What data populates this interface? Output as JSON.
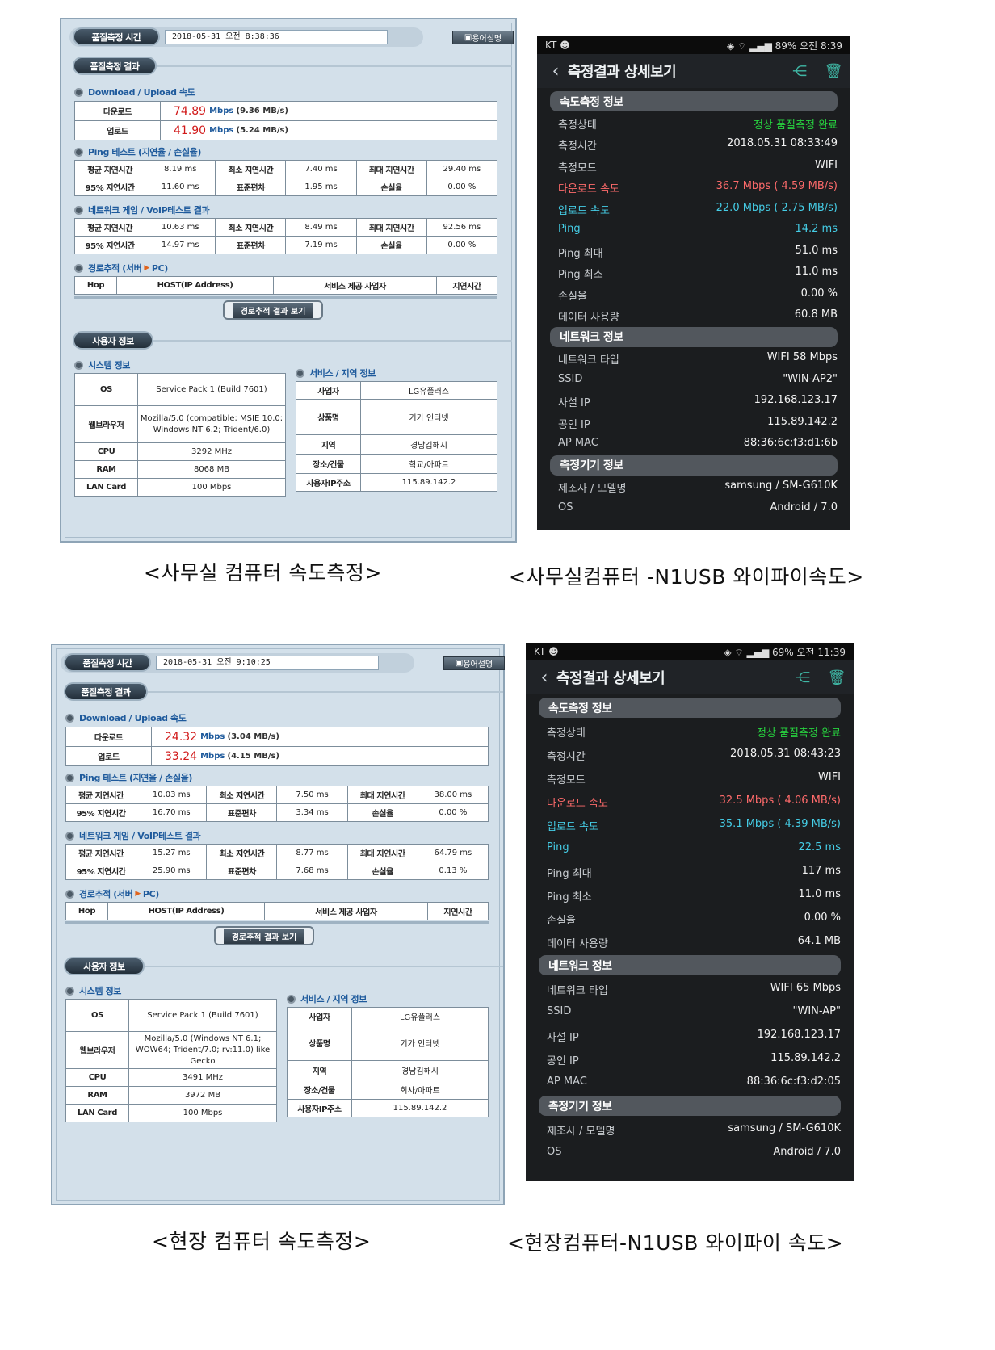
{
  "labels": {
    "time_title": "품질측정 시간",
    "help_button": "용어설명",
    "result_title": "품질측정 결과",
    "dl_ul_title": "Download / Upload 속도",
    "download": "다운로드",
    "upload": "업로드",
    "ping_title": "Ping 테스트 (지연율 / 손실율)",
    "voip_title": "네트워크 게임 / VoIP테스트 결과",
    "avg_delay": "평균 지연시간",
    "min_delay": "최소 지연시간",
    "max_delay": "최대 지연시간",
    "p95_delay": "95% 지연시간",
    "stddev": "표준편차",
    "loss": "손실율",
    "route_title_a": "경로추적 (서버",
    "route_title_b": "PC)",
    "hop": "Hop",
    "host": "HOST(IP Address)",
    "isp_col": "서비스 제공 사업자",
    "delay_col": "지연시간",
    "route_button": "경로추적 결과 보기",
    "user_title": "사용자 정보",
    "system_title": "시스템 정보",
    "service_title": "서비스 / 지역 정보",
    "os": "OS",
    "browser": "웹브라우저",
    "cpu": "CPU",
    "ram": "RAM",
    "lan": "LAN Card",
    "provider": "사업자",
    "product": "상품명",
    "region": "지역",
    "place": "장소/건물",
    "user_ip": "사용자IP주소",
    "mbps": "Mbps"
  },
  "phone_labels": {
    "carrier": "KT",
    "title": "측정결과 상세보기",
    "speed_section": "속도측정 정보",
    "network_section": "네트워크 정보",
    "device_section": "측정기기 정보",
    "state": "측정상태",
    "time": "측정시간",
    "mode": "측정모드",
    "download": "다운로드 속도",
    "upload": "업로드 속도",
    "ping": "Ping",
    "ping_max": "Ping 최대",
    "ping_min": "Ping 최소",
    "loss": "손실율",
    "data_used": "데이터 사용량",
    "net_type": "네트워크 타입",
    "ssid": "SSID",
    "private_ip": "사설 IP",
    "public_ip": "공인 IP",
    "ap_mac": "AP MAC",
    "maker": "제조사 / 모델명",
    "os": "OS"
  },
  "office_web": {
    "time": "2018-05-31 오전 8:38:36",
    "download_value": "74.89",
    "download_mb": "(9.36 MB/s)",
    "upload_value": "41.90",
    "upload_mb": "(5.24 MB/s)",
    "ping": {
      "avg": "8.19 ms",
      "min": "7.40 ms",
      "max": "29.40 ms",
      "p95": "11.60 ms",
      "std": "1.95 ms",
      "loss": "0.00 %"
    },
    "voip": {
      "avg": "10.63 ms",
      "min": "8.49 ms",
      "max": "92.56 ms",
      "p95": "14.97 ms",
      "std": "7.19 ms",
      "loss": "0.00 %"
    },
    "os": "Service Pack 1 (Build 7601)",
    "browser": "Mozilla/5.0 (compatible; MSIE 10.0; Windows NT 6.2; Trident/6.0)",
    "cpu": "3292 MHz",
    "ram": "8068 MB",
    "lan": "100 Mbps",
    "provider": "LG유플러스",
    "product": "기가 인터넷",
    "region": "경남김해시",
    "place": "학교/아파트",
    "ip": "115.89.142.2"
  },
  "office_phone": {
    "status_right": "89% 오전 8:39",
    "state": "정상 품질측정 완료",
    "time": "2018.05.31 08:33:49",
    "mode": "WIFI",
    "download": "36.7 Mbps ( 4.59 MB/s)",
    "upload": "22.0 Mbps ( 2.75 MB/s)",
    "ping": "14.2 ms",
    "ping_max": "51.0 ms",
    "ping_min": "11.0 ms",
    "loss": "0.00 %",
    "data_used": "60.8 MB",
    "net_type": "WIFI 58 Mbps",
    "ssid": "\"WIN-AP2\"",
    "private_ip": "192.168.123.17",
    "public_ip": "115.89.142.2",
    "ap_mac": "88:36:6c:f3:d1:6b",
    "maker": "samsung / SM-G610K",
    "os": "Android / 7.0"
  },
  "site_web": {
    "time": "2018-05-31 오전 9:10:25",
    "download_value": "24.32",
    "download_mb": "(3.04 MB/s)",
    "upload_value": "33.24",
    "upload_mb": "(4.15 MB/s)",
    "ping": {
      "avg": "10.03 ms",
      "min": "7.50 ms",
      "max": "38.00 ms",
      "p95": "16.70 ms",
      "std": "3.34 ms",
      "loss": "0.00 %"
    },
    "voip": {
      "avg": "15.27 ms",
      "min": "8.77 ms",
      "max": "64.79 ms",
      "p95": "25.90 ms",
      "std": "7.68 ms",
      "loss": "0.13 %"
    },
    "os": "Service Pack 1 (Build 7601)",
    "browser": "Mozilla/5.0 (Windows NT 6.1; WOW64; Trident/7.0; rv:11.0) like Gecko",
    "cpu": "3491 MHz",
    "ram": "3972 MB",
    "lan": "100 Mbps",
    "provider": "LG유플러스",
    "product": "기가 인터넷",
    "region": "경남김해시",
    "place": "회사/아파트",
    "ip": "115.89.142.2"
  },
  "site_phone": {
    "status_right": "69% 오전 11:39",
    "state": "정상 품질측정 완료",
    "time": "2018.05.31 08:43:23",
    "mode": "WIFI",
    "download": "32.5 Mbps ( 4.06 MB/s)",
    "upload": "35.1 Mbps ( 4.39 MB/s)",
    "ping": "22.5 ms",
    "ping_max": "117 ms",
    "ping_min": "11.0 ms",
    "loss": "0.00 %",
    "data_used": "64.1 MB",
    "net_type": "WIFI 65 Mbps",
    "ssid": "\"WIN-AP\"",
    "private_ip": "192.168.123.17",
    "public_ip": "115.89.142.2",
    "ap_mac": "88:36:6c:f3:d2:05",
    "maker": "samsung / SM-G610K",
    "os": "Android / 7.0"
  },
  "captions": {
    "office_web": "<사무실 컴퓨터 속도측정>",
    "office_phone": "<사무실컴퓨터 -N1USB 와이파이속도>",
    "site_web": "<현장 컴퓨터 속도측정>",
    "site_phone": "<현장컴퓨터-N1USB 와이파이 속도>"
  },
  "colors": {
    "panel_bg": "#d3e0ea",
    "accent_red": "#d11a1a",
    "phone_green": "#27d43f",
    "phone_red": "#ff6b6b",
    "phone_cyan": "#45cde6"
  }
}
